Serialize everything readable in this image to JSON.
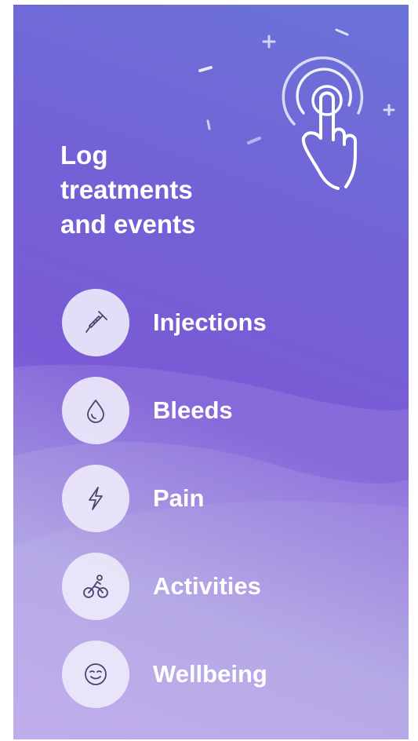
{
  "headline": {
    "line1": "Log",
    "line2": "treatments",
    "line3": "and events"
  },
  "categories": [
    {
      "label": "Injections",
      "icon": "syringe-icon"
    },
    {
      "label": "Bleeds",
      "icon": "drop-icon"
    },
    {
      "label": "Pain",
      "icon": "lightning-icon"
    },
    {
      "label": "Activities",
      "icon": "cyclist-icon"
    },
    {
      "label": "Wellbeing",
      "icon": "smiley-icon"
    }
  ],
  "colors": {
    "background_top": "#6b73d8",
    "background_middle": "#7a5ad6",
    "background_bottom": "#ae97e6",
    "icon_circle": "#ece8fa",
    "icon_stroke": "#4a4470",
    "text": "#ffffff"
  }
}
